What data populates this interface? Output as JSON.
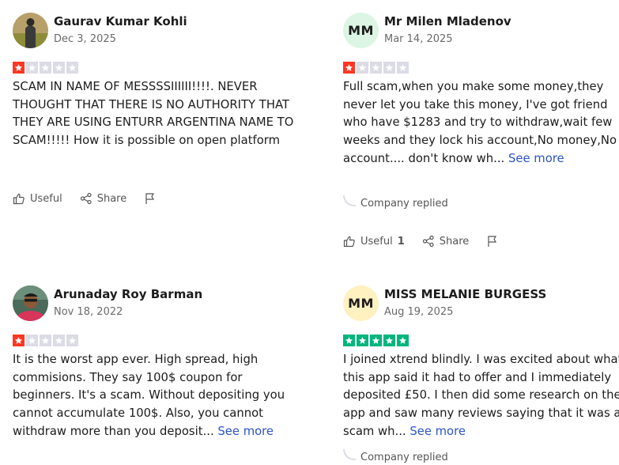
{
  "colors": {
    "star_red": "#ff3722",
    "star_green": "#00b67a",
    "star_empty": "#dcdce6",
    "link_blue": "#2b56c9"
  },
  "reviews": [
    {
      "name": "Gaurav Kumar Kohli",
      "date": "Dec 3, 2025",
      "rating": 1,
      "avatar": {
        "type": "photo"
      },
      "body": "SCAM IN NAME OF MESSSSIIIIII!!!!. NEVER THOUGHT THAT THERE IS NO AUTHORITY THAT THEY ARE USING ENTURR ARGENTINA NAME TO SCAM!!!!! How it is possible on open platform",
      "see_more": "",
      "company_replied": "",
      "actions": {
        "useful": "Useful",
        "useful_count": "",
        "share": "Share"
      }
    },
    {
      "name": "Mr Milen Mladenov",
      "date": "Mar 14, 2025",
      "rating": 1,
      "avatar": {
        "type": "initials",
        "initials": "MM",
        "bg": "#dcf5e4"
      },
      "body": "Full scam,when you make some money,they never let you take this money, I've got friend who have $1283 and try to withdraw,wait few weeks and they lock his account,No money,No account.... don't know wh...",
      "see_more": "See more",
      "company_replied": "Company replied",
      "actions": {
        "useful": "Useful",
        "useful_count": "1",
        "share": "Share"
      }
    },
    {
      "name": "Arunaday Roy Barman",
      "date": "Nov 18, 2022",
      "rating": 1,
      "avatar": {
        "type": "photo"
      },
      "body": "It is the worst app ever. High spread, high commisions. They say 100$ coupon for beginners. It's a scam. Without depositing you cannot accumulate 100$. Also, you cannot withdraw more than you deposit...",
      "see_more": "See more",
      "company_replied": "",
      "actions": null
    },
    {
      "name": "MISS MELANIE BURGESS",
      "date": "Aug 19, 2025",
      "rating": 5,
      "avatar": {
        "type": "initials",
        "initials": "MM",
        "bg": "#fff1c0"
      },
      "body": "I joined xtrend blindly. I was excited about what this app said it had to offer and I immediately deposited £50. I then did some research on the app and saw many reviews saying that it was a scam wh...",
      "see_more": "See more",
      "company_replied": "Company replied",
      "actions": null
    }
  ]
}
